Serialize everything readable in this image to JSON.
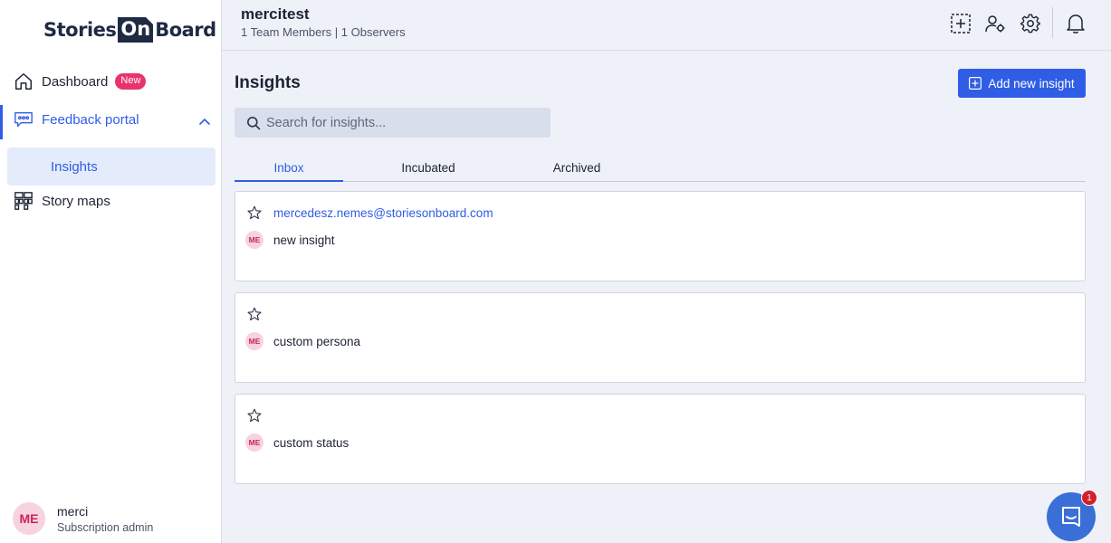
{
  "logo": {
    "part1": "Stories",
    "part2": "On",
    "part3": "Board"
  },
  "sidebar": {
    "items": [
      {
        "label": "Dashboard",
        "badge": "New"
      },
      {
        "label": "Feedback portal"
      },
      {
        "label": "Insights"
      },
      {
        "label": "Story maps"
      }
    ]
  },
  "user": {
    "initials": "ME",
    "name": "merci",
    "role": "Subscription admin"
  },
  "header": {
    "project_name": "mercitest",
    "project_meta": "1 Team Members | 1 Observers"
  },
  "main": {
    "title": "Insights",
    "add_button_label": "Add new insight",
    "search_placeholder": "Search for insights...",
    "tabs": [
      {
        "label": "Inbox"
      },
      {
        "label": "Incubated"
      },
      {
        "label": "Archived"
      }
    ],
    "insights": [
      {
        "email": "mercedesz.nemes@storiesonboard.com",
        "initials": "ME",
        "title": "new insight"
      },
      {
        "email": "",
        "initials": "ME",
        "title": "custom persona"
      },
      {
        "email": "",
        "initials": "ME",
        "title": "custom status"
      }
    ]
  },
  "chat": {
    "badge_count": "1"
  },
  "colors": {
    "accent": "#2f5de6",
    "badge_pink": "#e8346c",
    "avatar_bg": "#f7d3df",
    "chat_blue": "#3a6fd8",
    "notification_red": "#d4202b"
  }
}
